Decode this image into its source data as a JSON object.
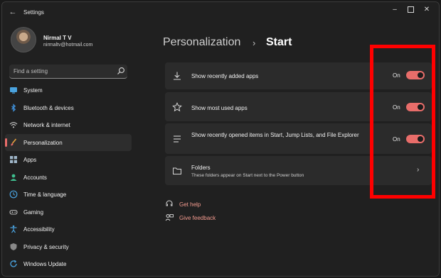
{
  "window": {
    "title": "Settings"
  },
  "user": {
    "name": "Nirmal T V",
    "email": "nirmaltv@hotmail.com"
  },
  "search": {
    "placeholder": "Find a setting"
  },
  "sidebar": {
    "items": [
      {
        "label": "System",
        "icon": "monitor-icon",
        "active": false
      },
      {
        "label": "Bluetooth & devices",
        "icon": "bluetooth-icon",
        "active": false
      },
      {
        "label": "Network & internet",
        "icon": "wifi-icon",
        "active": false
      },
      {
        "label": "Personalization",
        "icon": "brush-icon",
        "active": true
      },
      {
        "label": "Apps",
        "icon": "apps-icon",
        "active": false
      },
      {
        "label": "Accounts",
        "icon": "person-icon",
        "active": false
      },
      {
        "label": "Time & language",
        "icon": "globe-clock-icon",
        "active": false
      },
      {
        "label": "Gaming",
        "icon": "gamepad-icon",
        "active": false
      },
      {
        "label": "Accessibility",
        "icon": "accessibility-icon",
        "active": false
      },
      {
        "label": "Privacy & security",
        "icon": "shield-icon",
        "active": false
      },
      {
        "label": "Windows Update",
        "icon": "update-icon",
        "active": false
      }
    ]
  },
  "breadcrumb": {
    "parent": "Personalization",
    "separator": "›",
    "current": "Start"
  },
  "settings": [
    {
      "title": "Show recently added apps",
      "icon": "download-icon",
      "state": "On",
      "on": true
    },
    {
      "title": "Show most used apps",
      "icon": "star-icon",
      "state": "On",
      "on": true
    },
    {
      "title": "Show recently opened items in Start, Jump Lists, and File Explorer",
      "icon": "list-icon",
      "state": "On",
      "on": true
    },
    {
      "title": "Folders",
      "description": "These folders appear on Start next to the Power button",
      "icon": "folder-icon",
      "chevron": "›"
    }
  ],
  "links": {
    "help": "Get help",
    "feedback": "Give feedback"
  },
  "colors": {
    "accent": "#e86d6a",
    "link": "#f49b8f",
    "highlight": "#ff0000",
    "background": "#202020",
    "card": "#2b2b2b"
  }
}
